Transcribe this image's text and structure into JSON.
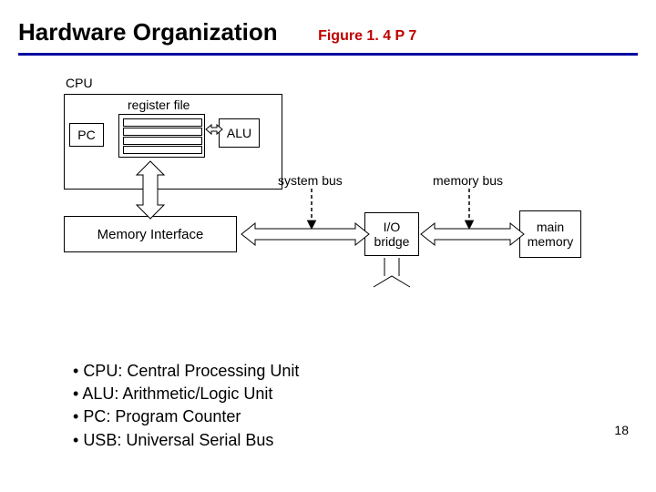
{
  "title": "Hardware Organization",
  "subtitle": "Figure 1. 4  P 7",
  "page_number": "18",
  "diagram": {
    "cpu_label": "CPU",
    "pc": "PC",
    "alu": "ALU",
    "register_file_label": "register file",
    "mem_if": "Memory Interface",
    "io_bridge": "I/O\nbridge",
    "main_memory": "main\nmemory",
    "system_bus": "system bus",
    "memory_bus": "memory bus"
  },
  "bullets": {
    "b1": "CPU:  Central Processing Unit",
    "b2": "ALU: Arithmetic/Logic Unit",
    "b3": "PC: Program Counter",
    "b4": "USB: Universal Serial Bus"
  }
}
